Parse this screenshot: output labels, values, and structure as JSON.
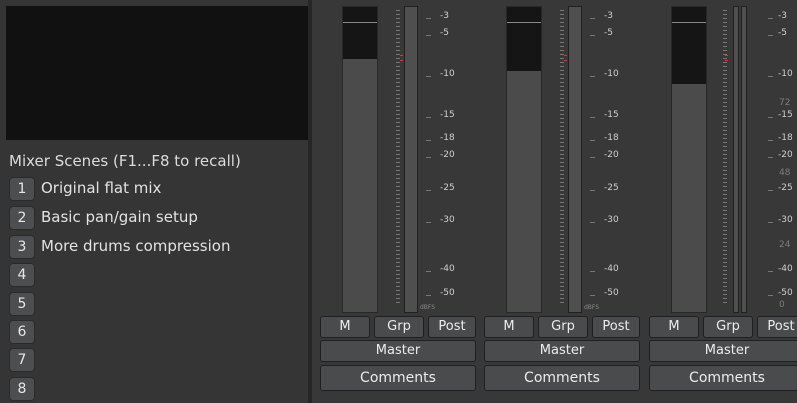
{
  "scenes": {
    "title": "Mixer Scenes (F1...F8 to recall)",
    "items": [
      {
        "num": "1",
        "label": "Original flat mix"
      },
      {
        "num": "2",
        "label": "Basic pan/gain setup"
      },
      {
        "num": "3",
        "label": "More drums compression"
      },
      {
        "num": "4",
        "label": ""
      },
      {
        "num": "5",
        "label": ""
      },
      {
        "num": "6",
        "label": ""
      },
      {
        "num": "7",
        "label": ""
      },
      {
        "num": "8",
        "label": ""
      }
    ]
  },
  "meter_scale": [
    "-3",
    "-5",
    "-10",
    "-15",
    "-18",
    "-20",
    "-25",
    "-30",
    "-40",
    "-50"
  ],
  "dbfs_label": "dBFS",
  "strips": [
    {
      "mute": "M",
      "group": "Grp",
      "post": "Post",
      "master": "Master",
      "comments": "Comments",
      "fader_level": 0.83
    },
    {
      "mute": "M",
      "group": "Grp",
      "post": "Post",
      "master": "Master",
      "comments": "Comments",
      "fader_level": 0.79
    },
    {
      "mute": "M",
      "group": "Grp",
      "post": "Post",
      "master": "Master",
      "comments": "Comments",
      "fader_level": 0.75,
      "extra_scale": [
        "72",
        "48",
        "24",
        "0"
      ]
    }
  ],
  "colors": {
    "peak_marker": "#c04040"
  }
}
